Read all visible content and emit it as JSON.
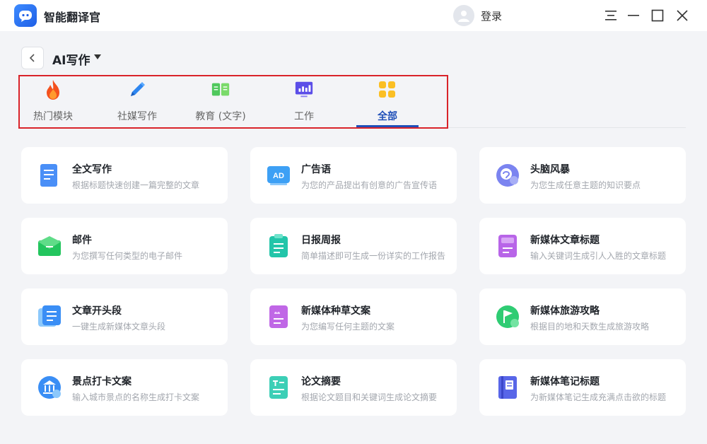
{
  "app": {
    "title": "智能翻译官",
    "login_label": "登录"
  },
  "page": {
    "title": "AI写作"
  },
  "tabs": [
    {
      "label": "热门模块",
      "icon": "fire-icon"
    },
    {
      "label": "社媒写作",
      "icon": "pen-icon"
    },
    {
      "label": "教育 (文字)",
      "icon": "book-icon"
    },
    {
      "label": "工作",
      "icon": "monitor-chart-icon"
    },
    {
      "label": "全部",
      "icon": "grid-icon",
      "active": true
    }
  ],
  "cards": [
    {
      "title": "全文写作",
      "desc": "根据标题快速创建一篇完整的文章",
      "icon": "document-icon"
    },
    {
      "title": "广告语",
      "desc": "为您的产品提出有创意的广告宣传语",
      "icon": "ad-icon"
    },
    {
      "title": "头脑风暴",
      "desc": "为您生成任意主题的知识要点",
      "icon": "brain-icon"
    },
    {
      "title": "邮件",
      "desc": "为您撰写任何类型的电子邮件",
      "icon": "mail-icon"
    },
    {
      "title": "日报周报",
      "desc": "简单描述即可生成一份详实的工作报告",
      "icon": "clipboard-icon"
    },
    {
      "title": "新媒体文章标题",
      "desc": "输入关键词生成引人入胜的文章标题",
      "icon": "title-icon"
    },
    {
      "title": "文章开头段",
      "desc": "一键生成新媒体文章头段",
      "icon": "paragraph-icon"
    },
    {
      "title": "新媒体种草文案",
      "desc": "为您编写任何主题的文案",
      "icon": "sprout-icon"
    },
    {
      "title": "新媒体旅游攻略",
      "desc": "根据目的地和天数生成旅游攻略",
      "icon": "flag-icon"
    },
    {
      "title": "景点打卡文案",
      "desc": "输入城市景点的名称生成打卡文案",
      "icon": "landmark-icon"
    },
    {
      "title": "论文摘要",
      "desc": "根据论文题目和关键词生成论文摘要",
      "icon": "abstract-icon"
    },
    {
      "title": "新媒体笔记标题",
      "desc": "为新媒体笔记生成充满点击欲的标题",
      "icon": "notebook-icon"
    }
  ]
}
